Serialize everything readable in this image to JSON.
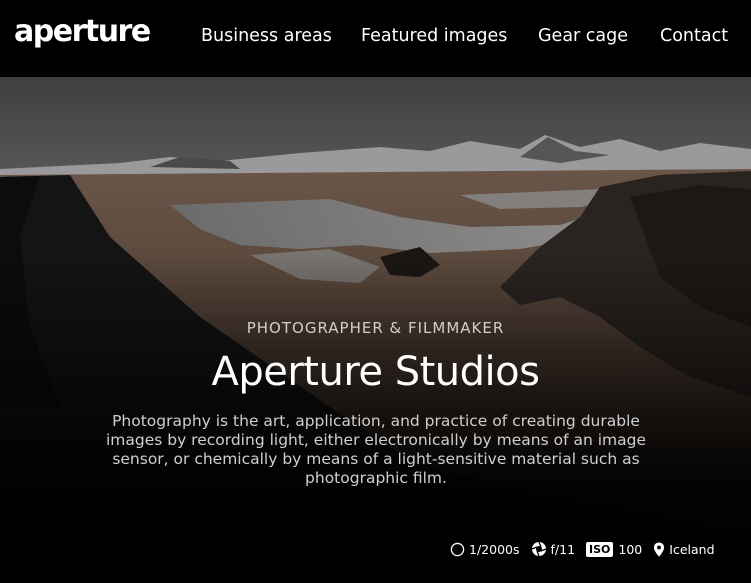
{
  "header": {
    "logo": "aperture",
    "nav": [
      {
        "label": "Business areas"
      },
      {
        "label": "Featured images"
      },
      {
        "label": "Gear cage"
      },
      {
        "label": "Contact"
      }
    ]
  },
  "hero": {
    "eyebrow": "PHOTOGRAPHER & FILMMAKER",
    "title": "Aperture Studios",
    "description": "Photography is the art, application, and practice of creating durable images by recording light, either electronically by means of an image sensor, or chemically by means of a light-sensitive material such as photographic film.",
    "image_alt": "Aerial landscape of Iceland"
  },
  "exif": {
    "shutter": {
      "icon": "shutter-icon",
      "value": "1/2000s"
    },
    "aperture": {
      "icon": "aperture-icon",
      "value": "f/11"
    },
    "iso": {
      "badge": "ISO",
      "value": "100"
    },
    "location": {
      "icon": "location-pin-icon",
      "value": "Iceland"
    }
  }
}
